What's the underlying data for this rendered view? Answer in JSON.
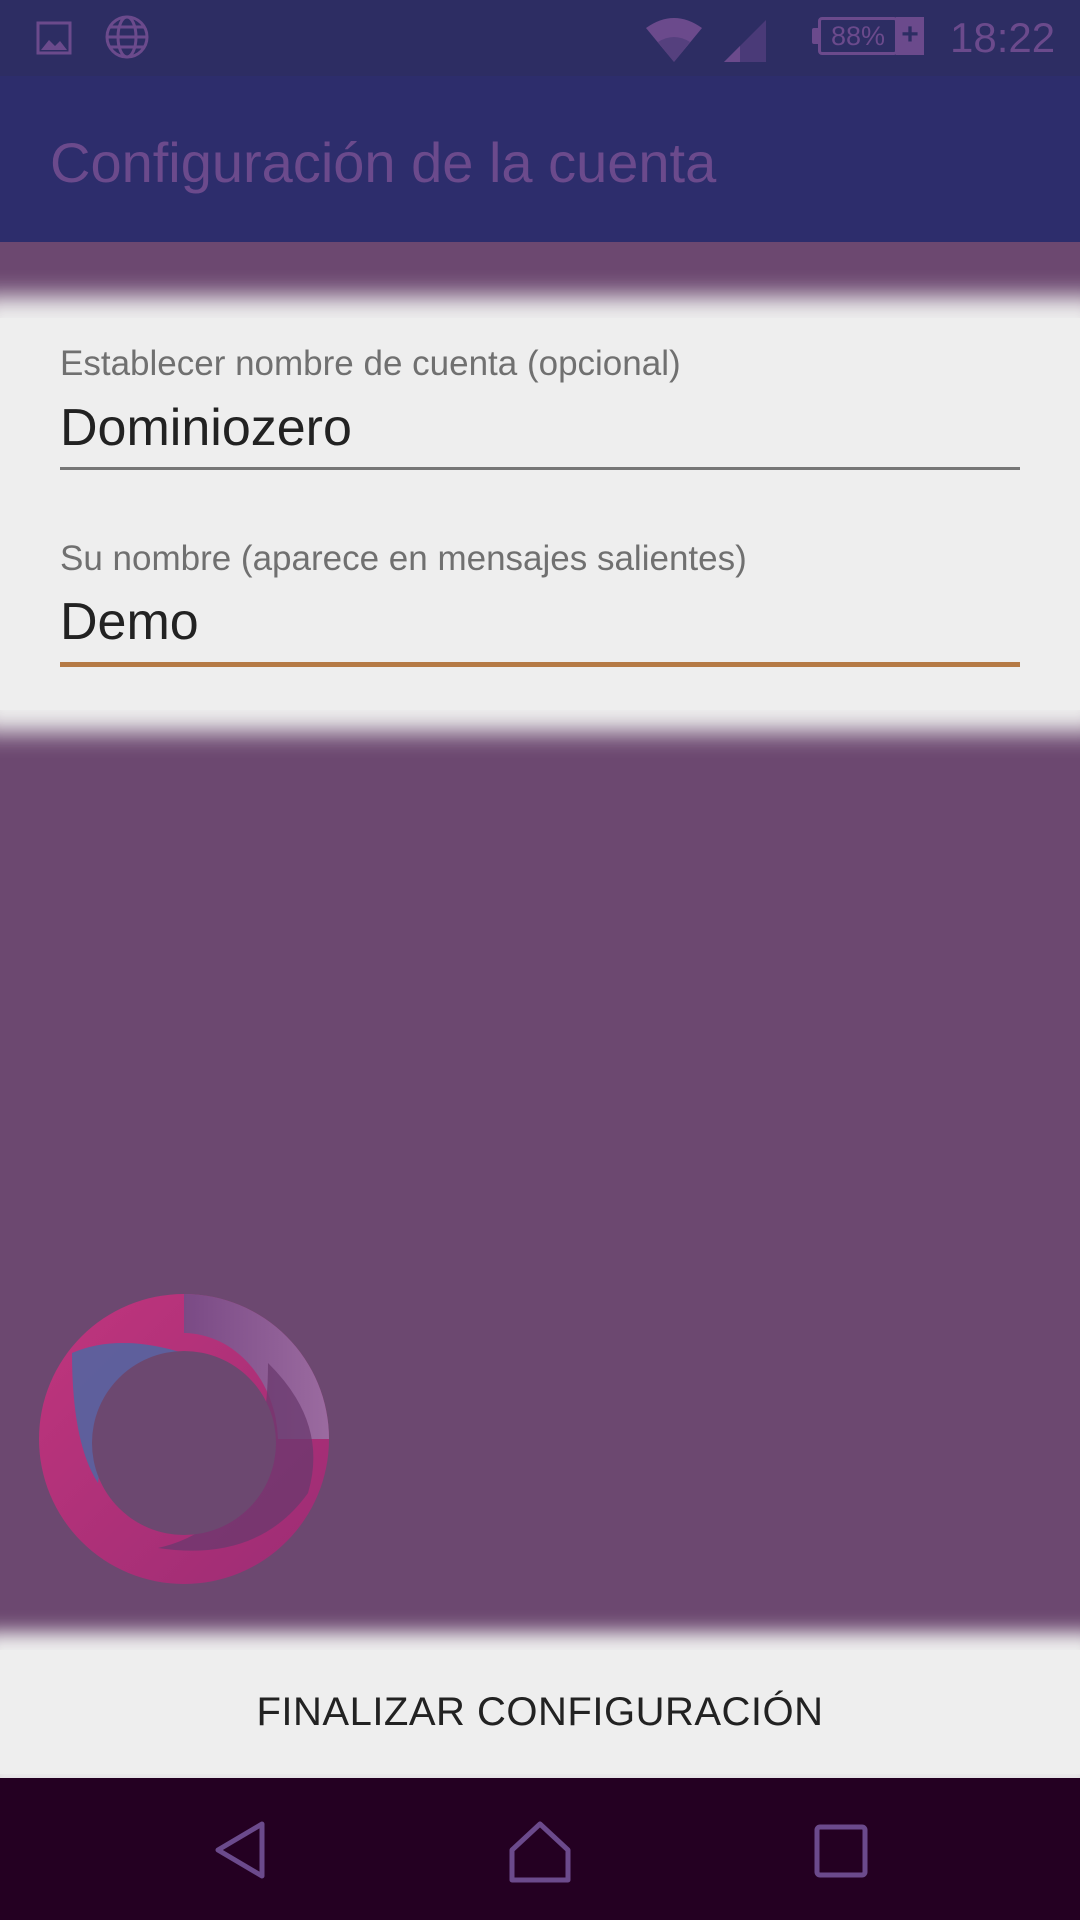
{
  "status_bar": {
    "battery_percent": "88%",
    "battery_plus": "+",
    "time": "18:22",
    "icons": [
      "gallery-icon",
      "globe-icon",
      "wifi-icon",
      "cell-signal-icon",
      "battery-icon"
    ]
  },
  "app_bar": {
    "title": "Configuración de la cuenta"
  },
  "form": {
    "account_name": {
      "label": "Establecer nombre de cuenta (opcional)",
      "value": "Dominiozero"
    },
    "your_name": {
      "label": "Su nombre (aparece en mensajes salientes)",
      "value": "Demo"
    }
  },
  "actions": {
    "finish_label": "FINALIZAR CONFIGURACIÓN"
  },
  "nav_bar": {
    "icons": [
      "back-icon",
      "home-icon",
      "recents-icon"
    ]
  },
  "colors": {
    "background": "#6c4870",
    "app_bar": "#2d2d6c",
    "status_bar": "#2d2d63",
    "accent": "#b57a45",
    "panel": "#eeeeee",
    "nav_bar": "#240022"
  }
}
